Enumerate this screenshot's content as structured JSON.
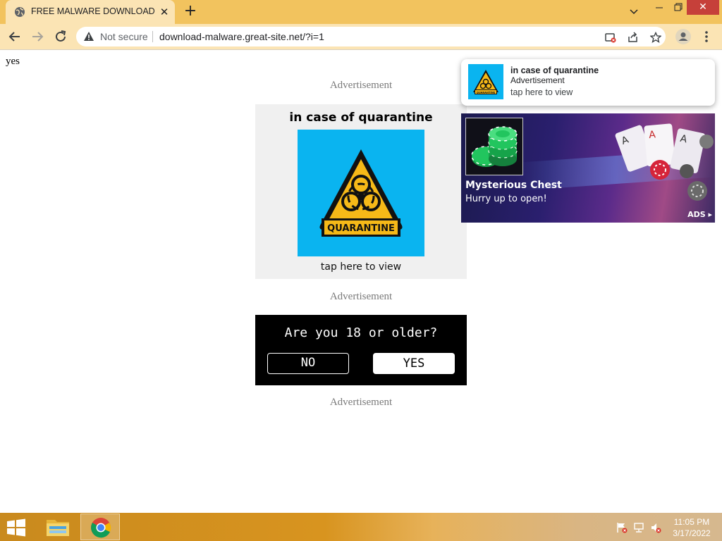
{
  "browser": {
    "tab": {
      "title": "FREE MALWARE DOWNLOAD",
      "favicon": "globe-icon",
      "close_icon": "close-icon"
    },
    "new_tab_icon": "plus-icon",
    "window_controls": [
      "chevron-down-icon",
      "minimize-icon",
      "restore-icon",
      "close-icon"
    ],
    "toolbar": {
      "back_icon": "arrow-left-icon",
      "forward_icon": "arrow-right-icon",
      "reload_icon": "reload-icon",
      "security_icon": "warning-icon",
      "security_label": "Not secure",
      "url": "download-malware.great-site.net/?i=1",
      "right_icons": [
        "notification-blocked-icon",
        "share-icon",
        "star-icon",
        "profile-icon",
        "kebab-menu-icon"
      ]
    },
    "colors": {
      "frame": "#f2c35e",
      "toolbar": "#fbe4b4",
      "close_hover": "#c6403a"
    }
  },
  "page": {
    "corner_text": "yes",
    "ad_label": "Advertisement",
    "quarantine_ad": {
      "title": "in case of quarantine",
      "image_label": "QUARANTINE",
      "image_icon": "biohazard-icon",
      "cta": "tap here to view",
      "colors": {
        "bg": "#0ab4f0",
        "sign": "#f6b918"
      }
    },
    "age_gate": {
      "question": "Are you 18 or older?",
      "no_label": "NO",
      "yes_label": "YES"
    }
  },
  "notification": {
    "title": "in case of quarantine",
    "subtitle": "Advertisement",
    "cta": "tap here to view",
    "image_label": "QUARANTINE"
  },
  "banner_ad": {
    "title": "Mysterious Chest",
    "subtitle": "Hurry up to open!",
    "badge": "ADS",
    "image_icon": "poker-chips-icon"
  },
  "taskbar": {
    "start_icon": "windows-logo-icon",
    "apps": [
      "file-explorer-icon",
      "chrome-icon"
    ],
    "tray_icons": [
      "action-center-flag-icon",
      "network-icon",
      "volume-muted-icon"
    ],
    "clock": {
      "time": "11:05 PM",
      "date": "3/17/2022"
    }
  }
}
